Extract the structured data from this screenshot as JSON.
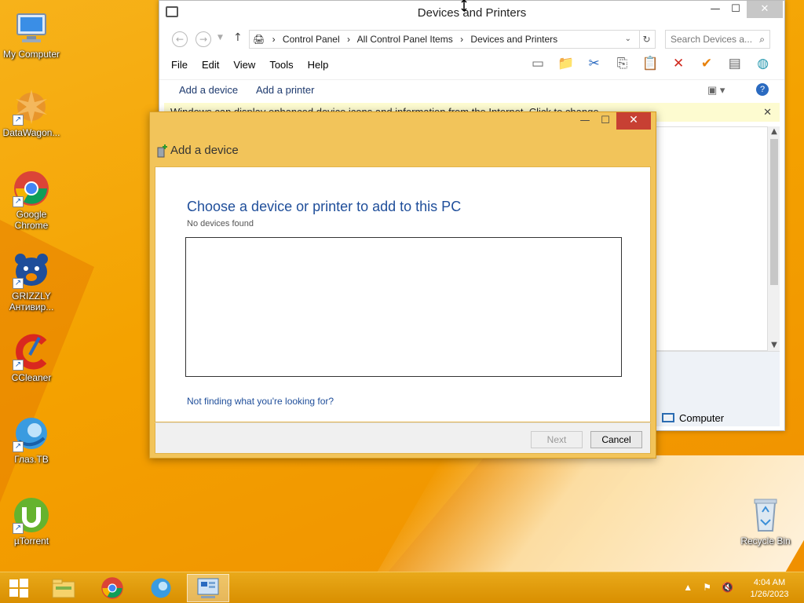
{
  "desktop": {
    "icons": [
      {
        "label": "My Computer"
      },
      {
        "label": "DataWagon..."
      },
      {
        "label": "Google Chrome"
      },
      {
        "label": "GRIZZLY Антивир..."
      },
      {
        "label": "CCleaner"
      },
      {
        "label": "Глаз.ТВ"
      },
      {
        "label": "µTorrent"
      },
      {
        "label": "Recycle Bin"
      }
    ]
  },
  "devices_window": {
    "title": "Devices and Printers",
    "breadcrumb": [
      "Control Panel",
      "All Control Panel Items",
      "Devices and Printers"
    ],
    "search_placeholder": "Search Devices a...",
    "menu": [
      "File",
      "Edit",
      "View",
      "Tools",
      "Help"
    ],
    "commands": {
      "add_device": "Add a device",
      "add_printer": "Add a printer"
    },
    "infobar": "Windows can display enhanced device icons and information from the Internet. Click to change...",
    "status_item": "Computer"
  },
  "dialog": {
    "title": "Add a device",
    "heading": "Choose a device or printer to add to this PC",
    "status": "No devices found",
    "help_link": "Not finding what you're looking for?",
    "next_label": "Next",
    "cancel_label": "Cancel"
  },
  "taskbar": {
    "time": "4:04 AM",
    "date": "1/26/2023"
  },
  "colors": {
    "desktop_accent": "#f4a200",
    "dialog_frame": "#f2c45a",
    "link_blue": "#1f4e9a",
    "close_red": "#c74033"
  }
}
